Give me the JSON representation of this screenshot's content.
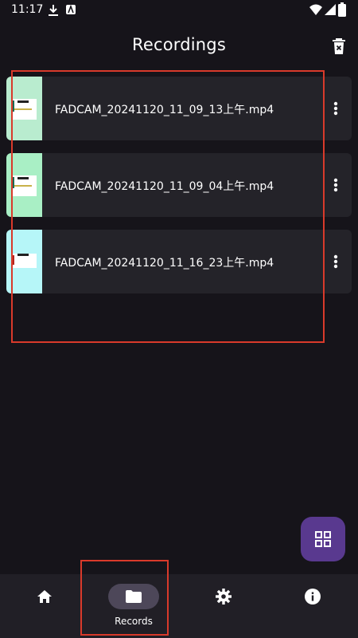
{
  "status_bar": {
    "time": "11:17"
  },
  "header": {
    "title": "Recordings"
  },
  "recordings": [
    {
      "name": "FADCAM_20241120_11_09_13上午.mp4",
      "thumb_color": "#b9eccf"
    },
    {
      "name": "FADCAM_20241120_11_09_04上午.mp4",
      "thumb_color": "#a9efc5"
    },
    {
      "name": "FADCAM_20241120_11_16_23上午.mp4",
      "thumb_color": "#b6f6f8"
    }
  ],
  "bottom_nav": {
    "items": [
      {
        "id": "home",
        "label": "",
        "icon": "home-icon",
        "active": false
      },
      {
        "id": "records",
        "label": "Records",
        "icon": "folder-icon",
        "active": true
      },
      {
        "id": "settings",
        "label": "",
        "icon": "gear-icon",
        "active": false
      },
      {
        "id": "about",
        "label": "",
        "icon": "info-icon",
        "active": false
      }
    ]
  },
  "colors": {
    "background": "#16141a",
    "card": "#242329",
    "fab": "#59398f",
    "nav_bar": "#211f26",
    "nav_active_pill": "#4d4759",
    "highlight": "#d93a2b"
  }
}
